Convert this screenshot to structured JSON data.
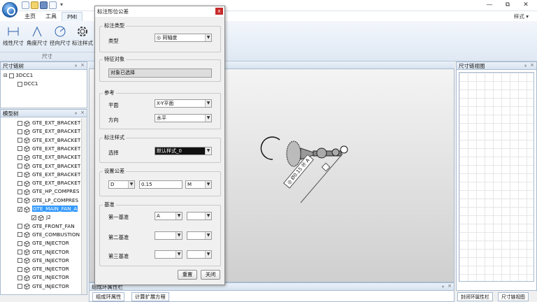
{
  "titlebar": {
    "quick_access": [
      "new",
      "open",
      "save",
      "print"
    ],
    "window_controls": [
      "—",
      "⧉",
      "✕"
    ]
  },
  "ribbon": {
    "tabs": [
      "主页",
      "工具",
      "PMI"
    ],
    "active_tab": "PMI",
    "buttons": [
      "线性尺寸",
      "角度尺寸",
      "径向尺寸",
      "标注样式"
    ],
    "group_label": "尺寸",
    "style_menu": "样式 ▾"
  },
  "dim_chain_tree": {
    "title": "尺寸链树",
    "items": [
      "3DCC1",
      "DCC1"
    ]
  },
  "model_tree": {
    "title": "模型树",
    "items": [
      {
        "label": "GTE_EXT_BRACKET",
        "checked": false,
        "selected": false
      },
      {
        "label": "GTE_EXT_BRACKET",
        "checked": false,
        "selected": false
      },
      {
        "label": "GTE_EXT_BRACKET",
        "checked": false,
        "selected": false
      },
      {
        "label": "GTE_EXT_BRACKET",
        "checked": false,
        "selected": false
      },
      {
        "label": "GTE_EXT_BRACKET",
        "checked": false,
        "selected": false
      },
      {
        "label": "GTE_EXT_BRACKET",
        "checked": false,
        "selected": false
      },
      {
        "label": "GTE_EXT_BRACKET",
        "checked": false,
        "selected": false
      },
      {
        "label": "GTE_EXT_BRACKET",
        "checked": false,
        "selected": false
      },
      {
        "label": "GTE_HP_COMPRES",
        "checked": false,
        "selected": false
      },
      {
        "label": "GTE_LP_COMPRES",
        "checked": false,
        "selected": false
      },
      {
        "label": "GTE_MAIN_FAN_A",
        "checked": true,
        "selected": true
      },
      {
        "label": "J2",
        "checked": true,
        "selected": false
      },
      {
        "label": "GTE_FRONT_FAN",
        "checked": false,
        "selected": false
      },
      {
        "label": "GTE_COMBUSTION",
        "checked": false,
        "selected": false
      },
      {
        "label": "GTE_INJECTOR",
        "checked": false,
        "selected": false
      },
      {
        "label": "GTE_INJECTOR",
        "checked": false,
        "selected": false
      },
      {
        "label": "GTE_INJECTOR",
        "checked": false,
        "selected": false
      },
      {
        "label": "GTE_INJECTOR",
        "checked": false,
        "selected": false
      },
      {
        "label": "GTE_INJECTOR",
        "checked": false,
        "selected": false
      },
      {
        "label": "GTE_INJECTOR",
        "checked": false,
        "selected": false
      }
    ]
  },
  "dialog": {
    "title": "标注形位公差",
    "close": "x",
    "group_type": {
      "title": "标注类型",
      "label": "类型",
      "value": "◎ 同轴度"
    },
    "group_feature": {
      "title": "特征对象",
      "value": "对象已选择"
    },
    "group_ref": {
      "title": "参考",
      "plane_label": "平面",
      "plane_value": "X-Y平面",
      "dir_label": "方向",
      "dir_value": "水平"
    },
    "group_style": {
      "title": "标注样式",
      "label": "选择",
      "value": "默认样式_0"
    },
    "group_tol": {
      "title": "设置公差",
      "sym": "D",
      "value": "0.15",
      "mod": "M"
    },
    "group_datum": {
      "title": "基准",
      "rows": [
        {
          "label": "第一基准",
          "a": "A",
          "b": ""
        },
        {
          "label": "第二基准",
          "a": "",
          "b": ""
        },
        {
          "label": "第三基准",
          "a": "",
          "b": ""
        }
      ]
    },
    "btn_reset": "重置",
    "btn_close": "关闭"
  },
  "viewport": {
    "annotation": "◎ Ø0.15 Ⓜ A"
  },
  "right_panel": {
    "title": "尺寸链视图"
  },
  "bottom": {
    "title": "组成环属性栏",
    "tabs": [
      "组成环属性",
      "计算扩展方程"
    ],
    "right_tabs": [
      "封闭环属性栏",
      "尺寸链视图"
    ]
  }
}
